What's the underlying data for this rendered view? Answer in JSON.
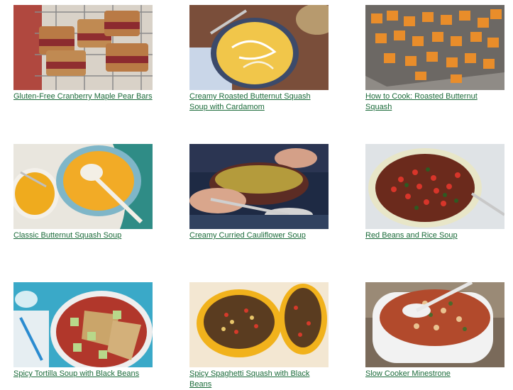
{
  "recipes": [
    {
      "title": "Gluten-Free Cranberry Maple Pear Bars",
      "image_icon": "cranberry-pear-bars-photo"
    },
    {
      "title": "Creamy Roasted Butternut Squash Soup with Cardamom",
      "image_icon": "butternut-squash-soup-photo"
    },
    {
      "title": "How to Cook: Roasted Butternut Squash",
      "image_icon": "roasted-squash-tray-photo"
    },
    {
      "title": "Classic Butternut Squash Soup",
      "image_icon": "classic-squash-soup-photo"
    },
    {
      "title": "Creamy Curried Cauliflower Soup",
      "image_icon": "cauliflower-soup-photo"
    },
    {
      "title": "Red Beans and Rice Soup",
      "image_icon": "red-beans-soup-photo"
    },
    {
      "title": "Spicy Tortilla Soup with Black Beans",
      "image_icon": "tortilla-soup-photo"
    },
    {
      "title": "Spicy Spaghetti Squash with Black Beans",
      "image_icon": "spaghetti-squash-photo"
    },
    {
      "title": "Slow Cooker Minestrone",
      "image_icon": "minestrone-photo"
    }
  ],
  "colors": {
    "link": "#1b6b3a",
    "background": "#ffffff"
  }
}
